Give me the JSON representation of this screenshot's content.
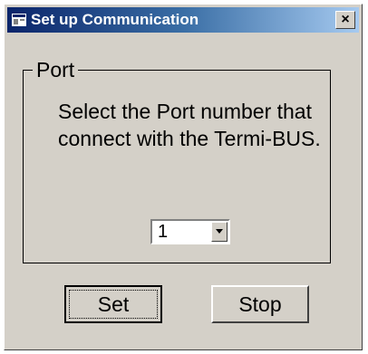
{
  "window": {
    "title": "Set up Communication",
    "close_label": "×"
  },
  "group": {
    "label": "Port",
    "instructions": "Select the Port number that connect with the Termi-BUS."
  },
  "port_select": {
    "selected": "1"
  },
  "buttons": {
    "set_label": "Set",
    "stop_label": "Stop"
  },
  "icons": {
    "app": "app-window-icon",
    "close": "close-icon",
    "dropdown": "chevron-down-icon"
  },
  "colors": {
    "titlebar_start": "#0a246a",
    "titlebar_end": "#a6caf0",
    "face": "#d4d0c8"
  }
}
